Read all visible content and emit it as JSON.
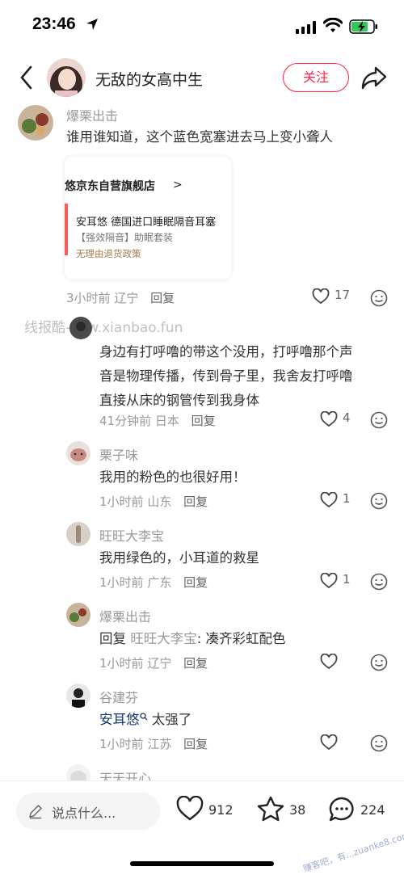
{
  "status_bar": {
    "time": "23:46"
  },
  "header": {
    "user_name": "无敌的女高中生",
    "follow_label": "关注"
  },
  "comments": [
    {
      "name": "爆栗出击",
      "text": "谁用谁知道，这个蓝色宽塞进去马上变小聋人",
      "product": {
        "shop": "耳悠京东自营旗舰店",
        "title": "安耳悠 德国进口睡眠隔音耳塞",
        "subtitle": "【强效隔音】助眠套装",
        "policy": "无理由退货政策"
      },
      "time": "3小时前",
      "location": "辽宁",
      "reply_label": "回复",
      "likes": "17"
    },
    {
      "name": "",
      "lines": [
        "身边有打呼噜的带这个没用，打呼噜那个声",
        "音是物理传播，传到骨子里，我舍友打呼噜",
        "直接从床的钢管传到我身体"
      ],
      "time": "41分钟前",
      "location": "日本",
      "reply_label": "回复",
      "likes": "4"
    },
    {
      "name": "栗子味",
      "text": "我用的粉色的也很好用！",
      "time": "1小时前",
      "location": "山东",
      "reply_label": "回复",
      "likes": "1"
    },
    {
      "name": "旺旺大李宝",
      "text": "我用绿色的，小耳道的救星",
      "time": "1小时前",
      "location": "广东",
      "reply_label": "回复",
      "likes": "1"
    },
    {
      "name": "爆栗出击",
      "reply_prefix": "回复",
      "reply_to": "旺旺大李宝",
      "text": ": 凑齐彩虹配色",
      "time": "1小时前",
      "location": "辽宁",
      "reply_label": "回复",
      "likes": ""
    },
    {
      "name": "谷建芬",
      "mention": "安耳悠",
      "text": " 太强了",
      "time": "1小时前",
      "location": "江苏",
      "reply_label": "回复",
      "likes": ""
    },
    {
      "name": "天天开心"
    }
  ],
  "watermark": "线报酷-new.xianbao.fun",
  "bottom_bar": {
    "input_placeholder": "说点什么...",
    "likes": "912",
    "favorites": "38",
    "comments": "224"
  },
  "corner_watermark": "赚客吧，有...zuanke8.com",
  "colors": {
    "accent": "#ff2442",
    "mention": "#13386c",
    "muted": "#999999"
  },
  "icons": [
    "navigation-arrow-icon",
    "signal-icon",
    "wifi-icon",
    "battery-charging-icon",
    "back-chevron-icon",
    "share-arrow-icon",
    "heart-icon",
    "emoji-icon",
    "pencil-icon",
    "star-icon",
    "chat-bubble-icon",
    "search-mention-icon"
  ]
}
